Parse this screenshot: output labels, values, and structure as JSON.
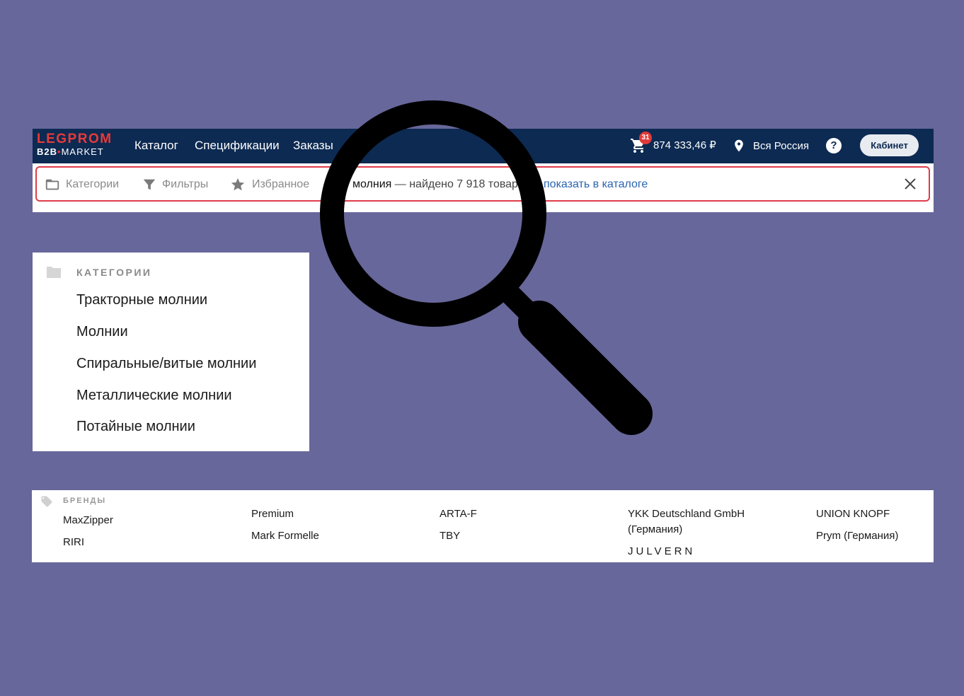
{
  "header": {
    "logo": {
      "top": "LEGPROM",
      "b2b": "B2B",
      "market": "MARKET"
    },
    "nav": [
      "Каталог",
      "Спецификации",
      "Заказы"
    ],
    "cart": {
      "badge": "31",
      "amount": "874 333,46 ₽"
    },
    "region": "Вся Россия",
    "help": "?",
    "cabinet": "Кабинет"
  },
  "search": {
    "tools": [
      "Категории",
      "Фильтры",
      "Избранное"
    ],
    "query": "молния",
    "result": " — найдено 7 918 товар",
    "link": "показать в каталоге"
  },
  "categories": {
    "title": "КАТЕГОРИИ",
    "items": [
      "Тракторные молнии",
      "Молнии",
      "Спиральные/витые молнии",
      "Металлические молнии",
      "Потайные молнии"
    ]
  },
  "brands": {
    "title": "БРЕНДЫ",
    "items": [
      "MaxZipper",
      "RIRI",
      "Premium",
      "Mark Formelle",
      "ARTA-F",
      "TBY",
      "YKK Deutschland GmbH",
      "(Германия)",
      "JULVERN",
      "UNION KNOPF",
      "Prym (Германия)"
    ]
  },
  "colors": {
    "navbar": "#0d2a52",
    "background": "#67679b",
    "accent": "#e13a4a",
    "link": "#2a64b0"
  },
  "icons": [
    "cart-icon",
    "location-pin-icon",
    "folder-icon",
    "filter-icon",
    "star-icon",
    "close-icon",
    "tag-icon",
    "magnifying-glass-icon"
  ]
}
